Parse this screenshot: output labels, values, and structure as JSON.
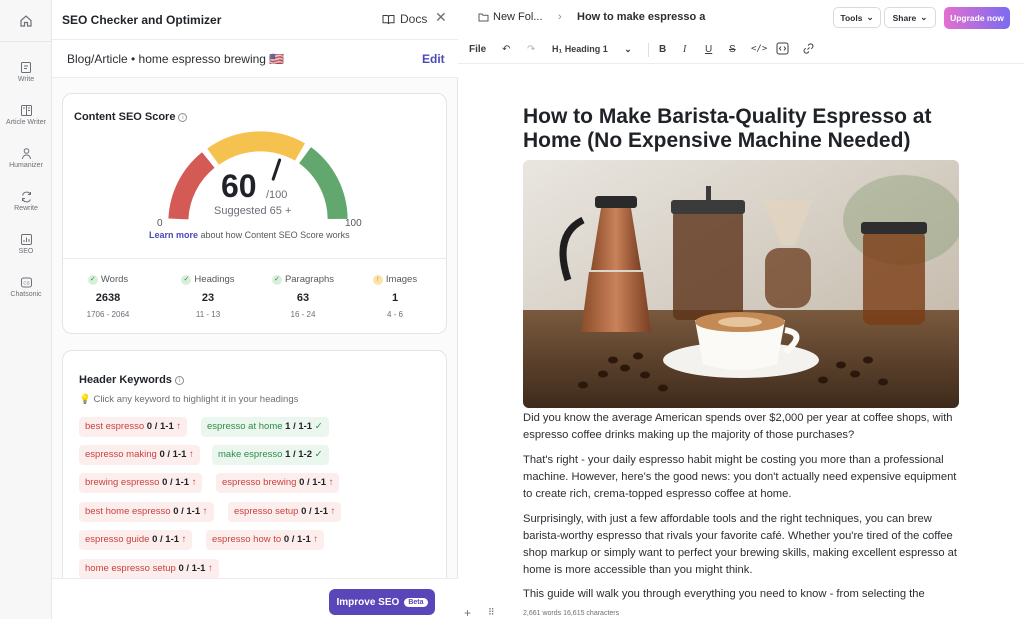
{
  "nav": {
    "items": [
      {
        "label": "Write",
        "icon": "write-icon"
      },
      {
        "label": "Article Writer",
        "icon": "article-writer-icon"
      },
      {
        "label": "Humanizer",
        "icon": "humanizer-icon"
      },
      {
        "label": "Rewrite",
        "icon": "rewrite-icon"
      },
      {
        "label": "SEO",
        "icon": "seo-icon"
      },
      {
        "label": "Chatsonic",
        "icon": "chatsonic-icon"
      }
    ]
  },
  "panel": {
    "title": "SEO Checker and Optimizer",
    "docs_label": "Docs",
    "topic": "Blog/Article • home espresso brewing 🇺🇸",
    "edit_label": "Edit",
    "score": {
      "title": "Content SEO Score",
      "value": "60",
      "out_of": "/100",
      "suggested": "Suggested  65 +",
      "min": "0",
      "max": "100",
      "learn_more_link": "Learn more",
      "learn_more_rest": "about how Content SEO Score works"
    },
    "stats": [
      {
        "label": "Words",
        "value": "2638",
        "range": "1706 - 2064",
        "status": "ok"
      },
      {
        "label": "Headings",
        "value": "23",
        "range": "11 - 13",
        "status": "ok"
      },
      {
        "label": "Paragraphs",
        "value": "63",
        "range": "16 - 24",
        "status": "ok"
      },
      {
        "label": "Images",
        "value": "1",
        "range": "4 - 6",
        "status": "increase"
      }
    ],
    "keywords": {
      "title": "Header Keywords",
      "hint": "Click any keyword to highlight it in your headings",
      "items": [
        {
          "text": "best espresso",
          "count": "0 / 1-1",
          "state": "missing"
        },
        {
          "text": "espresso at home",
          "count": "1 / 1-1",
          "state": "ok"
        },
        {
          "text": "espresso making",
          "count": "0 / 1-1",
          "state": "missing"
        },
        {
          "text": "make espresso",
          "count": "1 / 1-2",
          "state": "ok"
        },
        {
          "text": "brewing espresso",
          "count": "0 / 1-1",
          "state": "missing"
        },
        {
          "text": "espresso brewing",
          "count": "0 / 1-1",
          "state": "missing"
        },
        {
          "text": "best home espresso",
          "count": "0 / 1-1",
          "state": "missing"
        },
        {
          "text": "espresso setup",
          "count": "0 / 1-1",
          "state": "missing"
        },
        {
          "text": "espresso guide",
          "count": "0 / 1-1",
          "state": "missing"
        },
        {
          "text": "espresso how to",
          "count": "0 / 1-1",
          "state": "missing"
        },
        {
          "text": "home espresso setup",
          "count": "0 / 1-1",
          "state": "missing"
        }
      ]
    },
    "improve_label": "Improve SEO",
    "beta_label": "Beta"
  },
  "editor": {
    "breadcrumb": {
      "folder": "New Fol...",
      "doc": "How to make espresso a"
    },
    "tools_label": "Tools",
    "share_label": "Share",
    "upgrade_label": "Upgrade now",
    "toolbar": {
      "file": "File",
      "heading": "Heading 1"
    },
    "title": "How to Make Barista-Quality Espresso at Home (No Expensive Machine Needed)",
    "paragraphs": [
      " Did you know the average American spends over $2,000 per year at coffee shops, with espresso coffee drinks making up the majority of those purchases?",
      "That's right - your daily espresso habit might be costing you more than a professional machine. However, here's the good news: you don't actually need expensive equipment to create rich, crema-topped espresso coffee at home.",
      "Surprisingly, with just a few affordable tools and the right techniques, you can brew barista-worthy espresso that rivals your favorite café. Whether you're tired of the coffee shop markup or simply want to perfect your brewing skills, making excellent espresso at home is more accessible than you might think.",
      "This guide will walk you through everything you need to know - from selecting the"
    ],
    "status": "2,661 words  16,615 characters"
  },
  "colors": {
    "accent": "#5a46b8",
    "gauge_red": "#d45a55",
    "gauge_yellow": "#f5c24f",
    "gauge_green": "#62a86e"
  }
}
